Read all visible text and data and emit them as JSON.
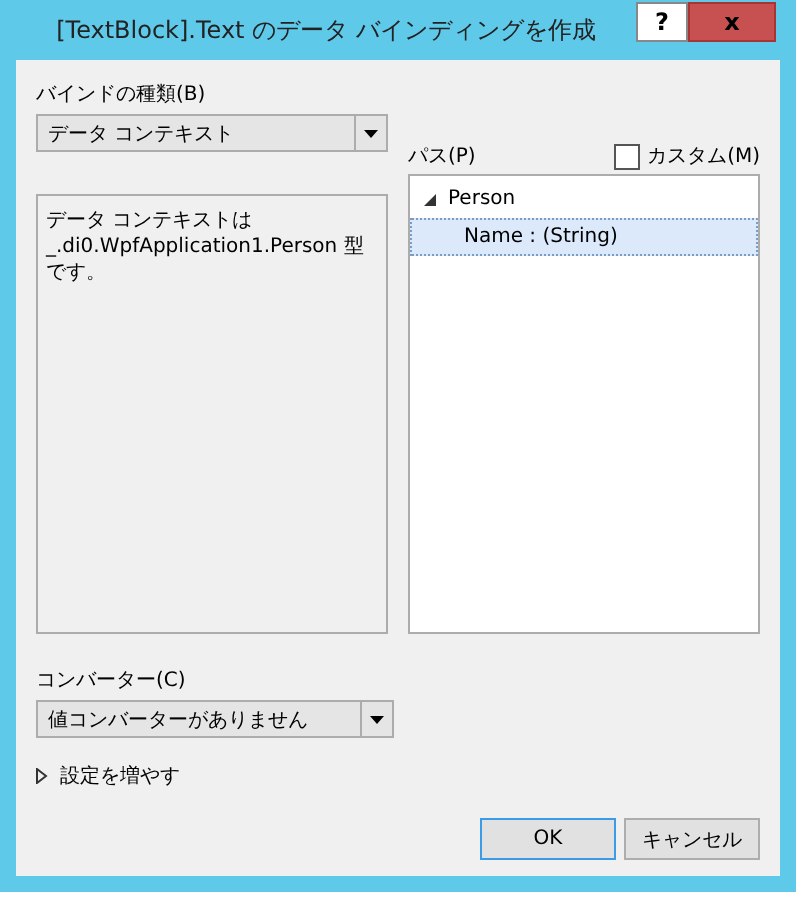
{
  "window": {
    "title": "[TextBlock].Text のデータ バインディングを作成",
    "help_button": "?",
    "close_button": "x"
  },
  "binding_type": {
    "label": "バインドの種類(B)",
    "value": "データ コンテキスト"
  },
  "description": "データ コンテキストは _.di0.WpfApplication1.Person 型です。",
  "path": {
    "label": "パス(P)",
    "custom": {
      "label": "カスタム(M)",
      "checked": false
    },
    "tree": [
      {
        "label": "Person",
        "expanded": true,
        "selected": false,
        "children": [
          {
            "label": "Name : (String)",
            "selected": true
          }
        ]
      }
    ]
  },
  "converter": {
    "label": "コンバーター(C)",
    "value": "値コンバーターがありません"
  },
  "more_settings": {
    "label": "設定を増やす",
    "expanded": false
  },
  "buttons": [
    {
      "label": "OK",
      "default": true
    },
    {
      "label": "キャンセル",
      "default": false
    }
  ]
}
